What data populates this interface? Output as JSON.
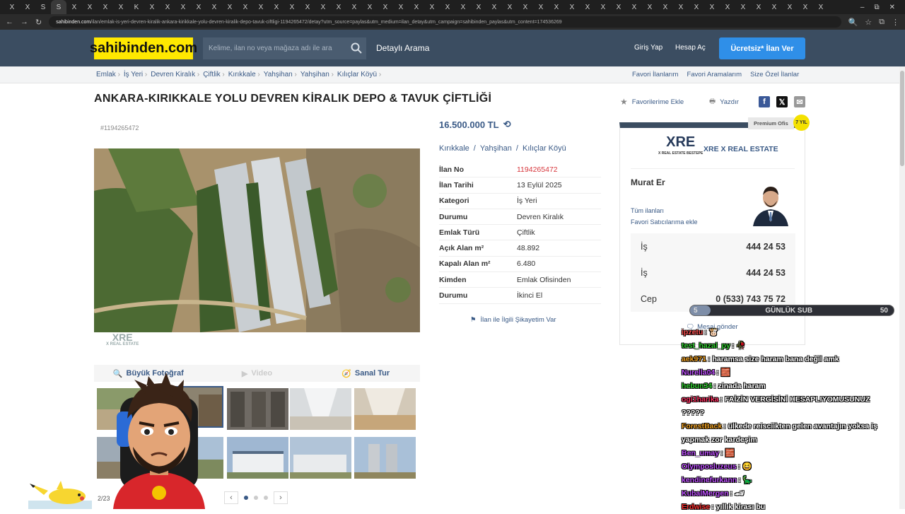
{
  "browser": {
    "tabs": [
      "X",
      "X",
      "S",
      "S",
      "X",
      "X",
      "X",
      "X",
      "K",
      "X",
      "X",
      "X",
      "X",
      "X",
      "X",
      "X",
      "X",
      "X",
      "X",
      "X",
      "X",
      "X",
      "X",
      "X",
      "X",
      "X",
      "X",
      "X",
      "X",
      "X",
      "X",
      "X",
      "X",
      "X",
      "X",
      "X",
      "X",
      "X",
      "X",
      "X",
      "X",
      "X",
      "X",
      "X",
      "X",
      "X",
      "X",
      "X",
      "X",
      "X",
      "X",
      "X",
      "X"
    ],
    "window_controls": [
      "–",
      "⧉",
      "✕"
    ],
    "url_host": "sahibinden.com",
    "url_path": "/ilan/emlak-is-yeri-devren-kiralik-ankara-kirikkale-yolu-devren-kiralik-depo-tavuk-ciftligi-1194265472/detay?utm_source=paylas&utm_medium=ilan_detay&utm_campaign=sahibinden_paylas&utm_content=174536269"
  },
  "header": {
    "logo": "sahibinden.com",
    "search_placeholder": "Kelime, ilan no veya mağaza adı ile ara",
    "detailed_search": "Detaylı Arama",
    "login": "Giriş Yap",
    "register": "Hesap Aç",
    "post_button": "Ücretsiz* İlan Ver"
  },
  "breadcrumbs": [
    "Emlak",
    "İş Yeri",
    "Devren Kiralık",
    "Çiftlik",
    "Kırıkkale",
    "Yahşihan",
    "Yahşihan",
    "Kılıçlar Köyü"
  ],
  "quick_links": [
    "Favori İlanlarım",
    "Favori Aramalarım",
    "Size Özel İlanlar"
  ],
  "listing": {
    "title": "ANKARA-KIRIKKALE YOLU DEVREN KİRALIK DEPO & TAVUK ÇİFTLİĞİ",
    "id_small": "#1194265472",
    "favorite": "Favorilerime Ekle",
    "print": "Yazdır",
    "price": "16.500.000 TL",
    "location": [
      "Kırıkkale",
      "/",
      "Yahşihan",
      "/",
      "Kılıçlar Köyü"
    ],
    "details": [
      {
        "k": "İlan No",
        "v": "1194265472"
      },
      {
        "k": "İlan Tarihi",
        "v": "13 Eylül 2025"
      },
      {
        "k": "Kategori",
        "v": "İş Yeri"
      },
      {
        "k": "Durumu",
        "v": "Devren Kiralık"
      },
      {
        "k": "Emlak Türü",
        "v": "Çiftlik"
      },
      {
        "k": "Açık Alan m²",
        "v": "48.892"
      },
      {
        "k": "Kapalı Alan m²",
        "v": "6.480"
      },
      {
        "k": "Kimden",
        "v": "Emlak Ofisinden"
      },
      {
        "k": "Durumu",
        "v": "İkinci El"
      }
    ],
    "complaint": "İlan ile İlgili Şikayetim Var",
    "media_tabs": [
      "Büyük Fotoğraf",
      "Video",
      "Sanal Tur"
    ],
    "photo_count": "2/23",
    "watermark": "XRE",
    "watermark_sub": "X REAL ESTATE"
  },
  "seller": {
    "premium": "Premium Ofis",
    "badge": "7 YIL",
    "office_logo": "XRE",
    "office_logo_sub": "X REAL ESTATE BESTEPE",
    "office_name": "XRE X REAL ESTATE",
    "agent": "Murat Er",
    "all_listings": "Tüm ilanları",
    "fav_seller": "Favori Satıcılarıma ekle",
    "phones": [
      {
        "label": "İş",
        "number": "444 24 53"
      },
      {
        "label": "İş",
        "number": "444 24 53"
      },
      {
        "label": "Cep",
        "number": "0 (533) 743 75 72"
      }
    ],
    "message": "Mesaj gönder"
  },
  "stream": {
    "sub_goal": {
      "current": "5",
      "label": "GÜNLÜK SUB",
      "target": "50",
      "progress": 0.1
    },
    "chat": [
      {
        "user": "ipzetu",
        "color": "#ff4f4f",
        "msg": "🐮"
      },
      {
        "user": "test_hazal_py",
        "color": "#2fd12f",
        "msg": "🥀"
      },
      {
        "user": "aek971",
        "color": "#f0a020",
        "msg": "haramsa size haram bana değil amk"
      },
      {
        "user": "Nurella04",
        "color": "#c050ff",
        "msg": "🧱"
      },
      {
        "user": "hebun34",
        "color": "#2fd12f",
        "msg": "zinada haram"
      },
      {
        "user": "ogi1harika",
        "color": "#ff3060",
        "msg": "FAİZİN VERGİSİNİ HESAPLIYOMUSUNUZ ?????"
      },
      {
        "user": "ForestBack",
        "color": "#f0a020",
        "msg": "ülkede reisciikten gelen avantajın yoksa iş yapmak zor kardeşim"
      },
      {
        "user": "Ben_umay",
        "color": "#c050ff",
        "msg": "🧱"
      },
      {
        "user": "Olymposluzeus",
        "color": "#c050ff",
        "msg": "😆"
      },
      {
        "user": "kendinefurkann",
        "color": "#c050ff",
        "msg": "🦕"
      },
      {
        "user": "KubalMergen",
        "color": "#c050ff",
        "msg": "🏎"
      },
      {
        "user": "Erdwise",
        "color": "#ff3030",
        "msg": "yıllık kirası bu"
      }
    ]
  },
  "colors": {
    "brand_yellow": "#ffe800",
    "header_bg": "#3b4d61",
    "link": "#3a5a86",
    "cta": "#2f8fe8",
    "red": "#d7383d"
  }
}
